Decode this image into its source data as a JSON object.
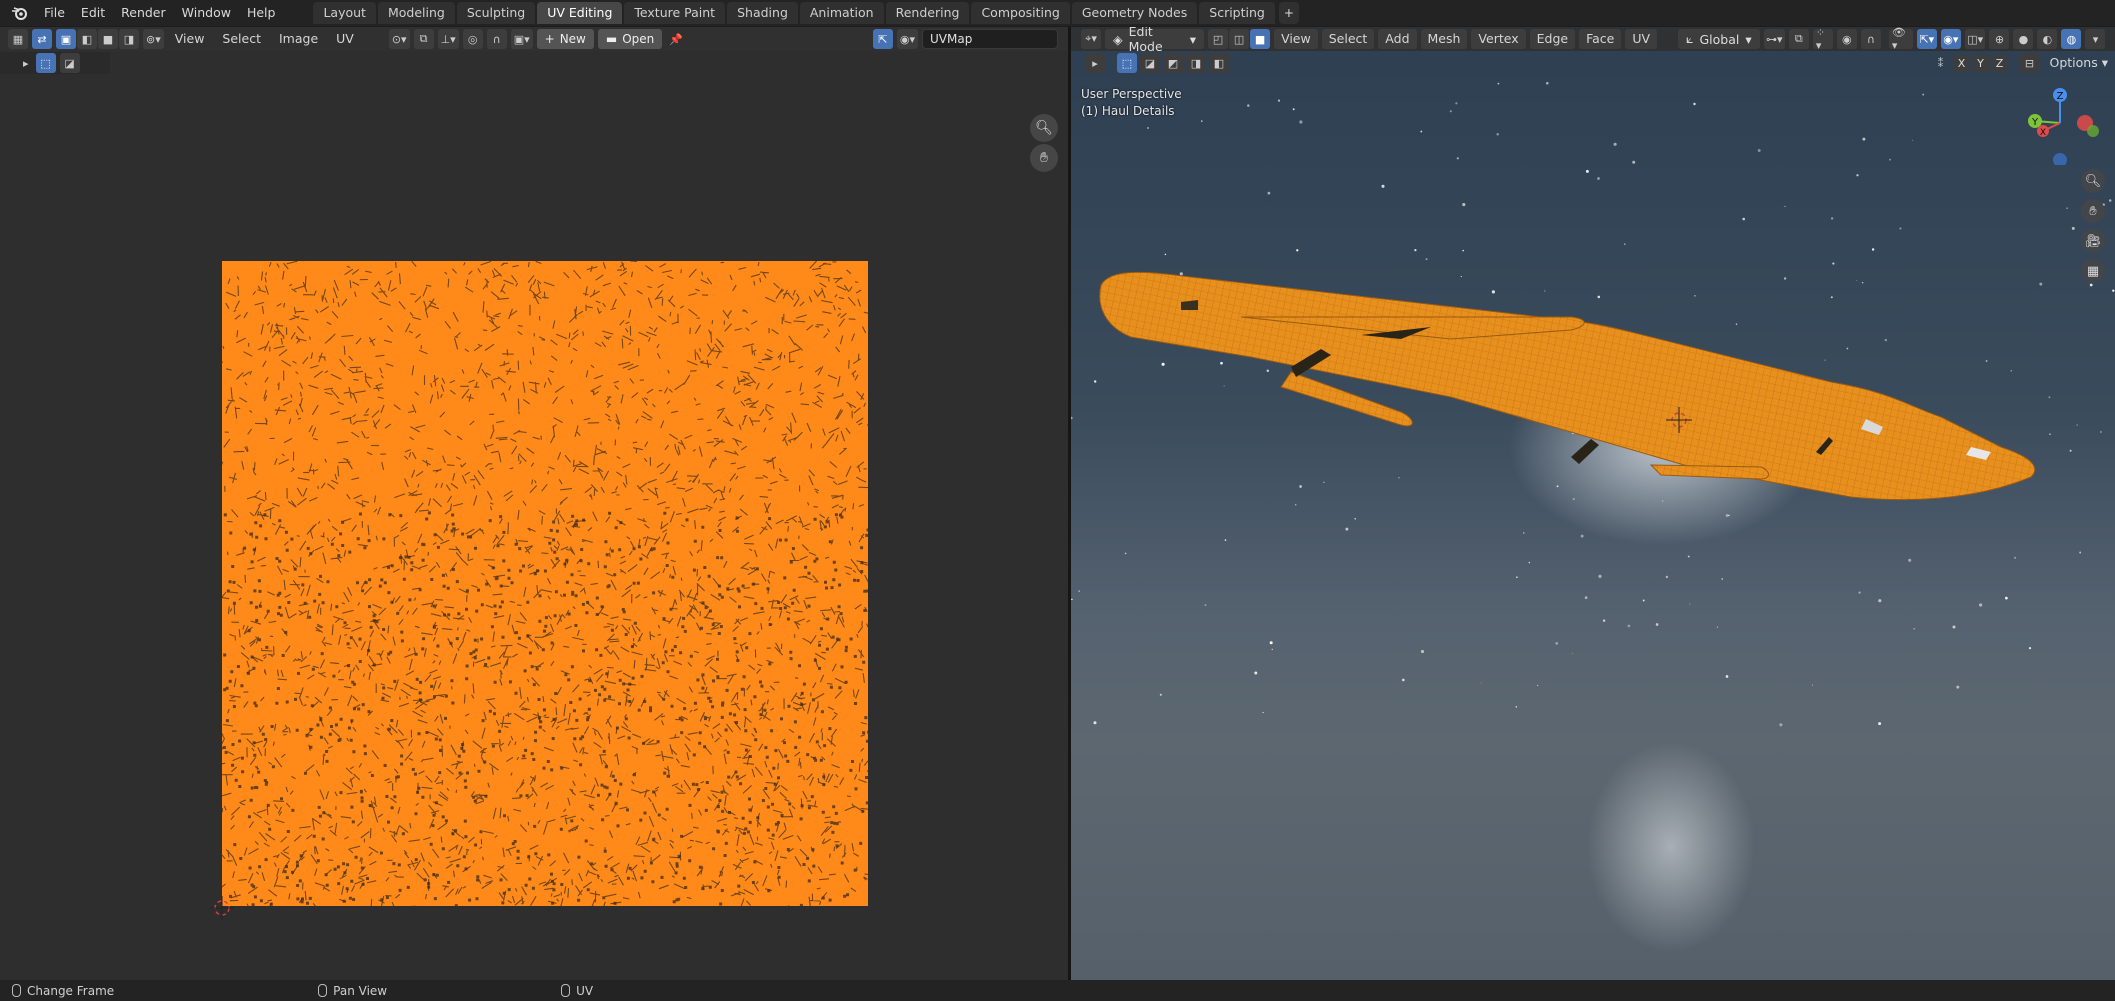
{
  "topbar": {
    "menus": [
      "File",
      "Edit",
      "Render",
      "Window",
      "Help"
    ],
    "workspaces": [
      "Layout",
      "Modeling",
      "Sculpting",
      "UV Editing",
      "Texture Paint",
      "Shading",
      "Animation",
      "Rendering",
      "Compositing",
      "Geometry Nodes",
      "Scripting"
    ],
    "active_workspace": "UV Editing",
    "add_tab": "+"
  },
  "uv_editor": {
    "menus": [
      "View",
      "Select",
      "Image",
      "UV"
    ],
    "new_label": "New",
    "open_label": "Open",
    "uv_map_name": "UVMap",
    "uv_color": "#ff8a1a"
  },
  "viewport": {
    "mode": "Edit Mode",
    "menus": [
      "View",
      "Select",
      "Add",
      "Mesh",
      "Vertex",
      "Edge",
      "Face",
      "UV"
    ],
    "orientation": "Global",
    "options_label": "Options",
    "axes": [
      "X",
      "Y",
      "Z"
    ],
    "perspective_label": "User Perspective",
    "object_label": "(1) Haul Details",
    "gizmo": {
      "x": "X",
      "y": "Y",
      "z": "Z"
    },
    "model_color": "#e8901e"
  },
  "statusbar": {
    "items": [
      {
        "icon": "mouse-left-icon",
        "label": "Change Frame"
      },
      {
        "icon": "mouse-middle-icon",
        "label": "Pan View"
      },
      {
        "icon": "mouse-right-icon",
        "label": "UV"
      }
    ]
  }
}
